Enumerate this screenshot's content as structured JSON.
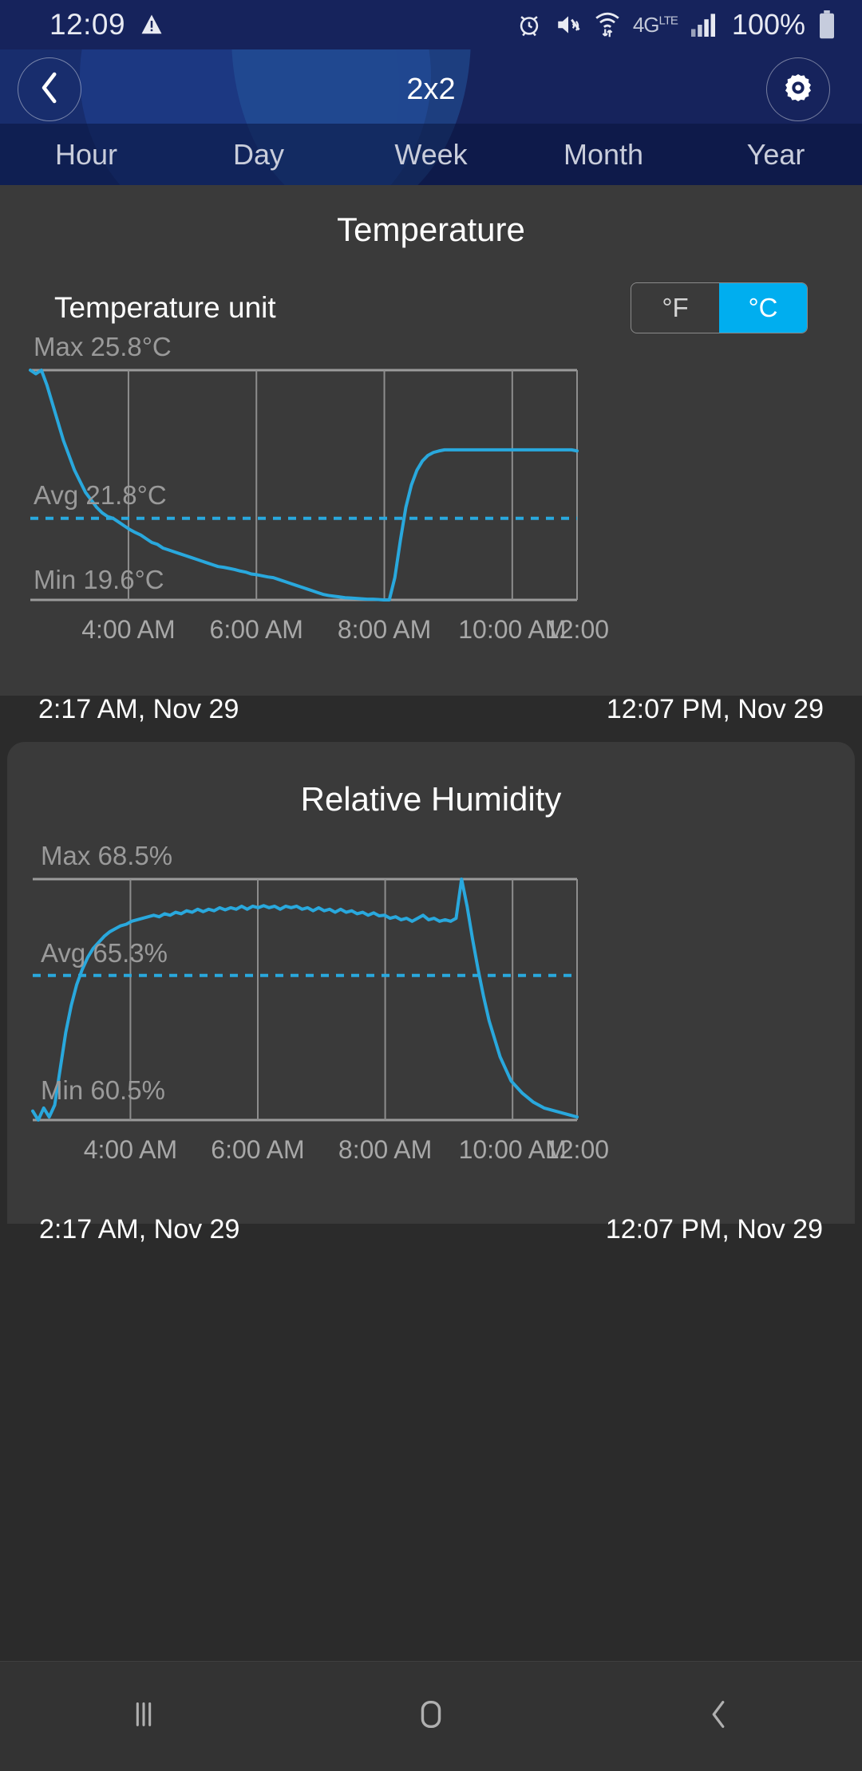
{
  "statusbar": {
    "time": "12:09",
    "battery_percent": "100%",
    "icons": [
      "warning-icon",
      "alarm-icon",
      "mute-icon",
      "wifi-icon",
      "network-4g-icon",
      "signal-icon",
      "battery-icon"
    ]
  },
  "header": {
    "title": "2x2",
    "back_icon": "chevron-left-icon",
    "settings_icon": "gear-icon"
  },
  "tabs": [
    {
      "label": "Hour",
      "selected": false
    },
    {
      "label": "Day",
      "selected": true
    },
    {
      "label": "Week",
      "selected": false
    },
    {
      "label": "Month",
      "selected": false
    },
    {
      "label": "Year",
      "selected": false
    }
  ],
  "temperature_card": {
    "title": "Temperature",
    "unit_label": "Temperature unit",
    "unit_options": [
      {
        "label": "°F",
        "selected": false
      },
      {
        "label": "°C",
        "selected": true
      }
    ],
    "accent_color": "#00aeef",
    "max_label": "Max 25.8°C",
    "avg_label": "Avg 21.8°C",
    "min_label": "Min 19.6°C",
    "range_start": "2:17 AM,  Nov 29",
    "range_end": "12:07 PM,  Nov 29"
  },
  "humidity_card": {
    "title": "Relative Humidity",
    "max_label": "Max 68.5%",
    "avg_label": "Avg 65.3%",
    "min_label": "Min 60.5%",
    "range_start": "2:17 AM,  Nov 29",
    "range_end": "12:07 PM,  Nov 29"
  },
  "bottom_nav": {
    "recents_icon": "recents-icon",
    "home_icon": "home-icon",
    "back_icon": "back-chevron-icon"
  },
  "chart_data": [
    {
      "type": "line",
      "title": "Temperature",
      "ylabel": "°C",
      "xlabel": "",
      "unit": "°C",
      "max": 25.8,
      "avg": 21.8,
      "min": 19.6,
      "ylim": [
        19.6,
        25.8
      ],
      "grid": true,
      "legend": "none",
      "xticks": [
        "4:00 AM",
        "6:00 AM",
        "8:00 AM",
        "10:00 AM",
        "12:00"
      ],
      "xtick_positions": [
        0.1795,
        0.4135,
        0.6475,
        0.8815,
        1.0
      ],
      "x_start": "2:17 AM, Nov 29",
      "x_end": "12:07 PM, Nov 29",
      "series": [
        {
          "name": "Temperature",
          "color": "#29a8dd",
          "values": [
            25.8,
            25.7,
            25.8,
            25.4,
            24.9,
            24.4,
            23.9,
            23.5,
            23.1,
            22.8,
            22.5,
            22.3,
            22.1,
            21.95,
            21.85,
            21.8,
            21.7,
            21.6,
            21.5,
            21.42,
            21.35,
            21.25,
            21.15,
            21.1,
            21.0,
            20.95,
            20.9,
            20.85,
            20.8,
            20.75,
            20.7,
            20.65,
            20.6,
            20.55,
            20.5,
            20.48,
            20.45,
            20.42,
            20.38,
            20.35,
            20.3,
            20.28,
            20.25,
            20.22,
            20.2,
            20.15,
            20.1,
            20.05,
            20.0,
            19.95,
            19.9,
            19.85,
            19.8,
            19.75,
            19.72,
            19.7,
            19.68,
            19.66,
            19.65,
            19.64,
            19.63,
            19.62,
            19.62,
            19.61,
            19.6,
            19.6,
            20.2,
            21.2,
            22.1,
            22.7,
            23.1,
            23.35,
            23.5,
            23.58,
            23.62,
            23.65,
            23.65,
            23.65,
            23.65,
            23.65,
            23.65,
            23.65,
            23.65,
            23.65,
            23.65,
            23.65,
            23.65,
            23.65,
            23.65,
            23.65,
            23.65,
            23.65,
            23.65,
            23.65,
            23.65,
            23.65,
            23.65,
            23.65,
            23.65,
            23.62
          ]
        }
      ],
      "avg_line": {
        "value": 21.8,
        "style": "dashed",
        "color": "#29a8dd"
      }
    },
    {
      "type": "line",
      "title": "Relative Humidity",
      "ylabel": "%",
      "xlabel": "",
      "unit": "%",
      "max": 68.5,
      "avg": 65.3,
      "min": 60.5,
      "ylim": [
        60.5,
        68.5
      ],
      "grid": true,
      "legend": "none",
      "xticks": [
        "4:00 AM",
        "6:00 AM",
        "8:00 AM",
        "10:00 AM",
        "12:00"
      ],
      "xtick_positions": [
        0.1795,
        0.4135,
        0.6475,
        0.8815,
        1.0
      ],
      "x_start": "2:17 AM, Nov 29",
      "x_end": "12:07 PM, Nov 29",
      "series": [
        {
          "name": "Relative Humidity",
          "color": "#29a8dd",
          "values": [
            60.8,
            60.5,
            60.9,
            60.6,
            61.0,
            62.2,
            63.4,
            64.3,
            65.0,
            65.5,
            65.9,
            66.2,
            66.4,
            66.6,
            66.75,
            66.85,
            66.95,
            67.0,
            67.1,
            67.15,
            67.2,
            67.25,
            67.3,
            67.25,
            67.35,
            67.3,
            67.4,
            67.35,
            67.45,
            67.4,
            67.5,
            67.42,
            67.5,
            67.45,
            67.55,
            67.48,
            67.55,
            67.5,
            67.6,
            67.5,
            67.6,
            67.55,
            67.62,
            67.55,
            67.6,
            67.5,
            67.6,
            67.55,
            67.6,
            67.5,
            67.55,
            67.45,
            67.55,
            67.45,
            67.5,
            67.4,
            67.5,
            67.4,
            67.45,
            67.35,
            67.4,
            67.3,
            67.38,
            67.28,
            67.3,
            67.2,
            67.25,
            67.15,
            67.2,
            67.1,
            67.2,
            67.3,
            67.15,
            67.2,
            67.1,
            67.15,
            67.1,
            67.2,
            68.5,
            67.6,
            66.5,
            65.5,
            64.6,
            63.8,
            63.2,
            62.6,
            62.2,
            61.8,
            61.6,
            61.4,
            61.25,
            61.1,
            61.0,
            60.9,
            60.85,
            60.8,
            60.75,
            60.7,
            60.65,
            60.6
          ]
        }
      ],
      "avg_line": {
        "value": 65.3,
        "style": "dashed",
        "color": "#29a8dd"
      }
    }
  ]
}
